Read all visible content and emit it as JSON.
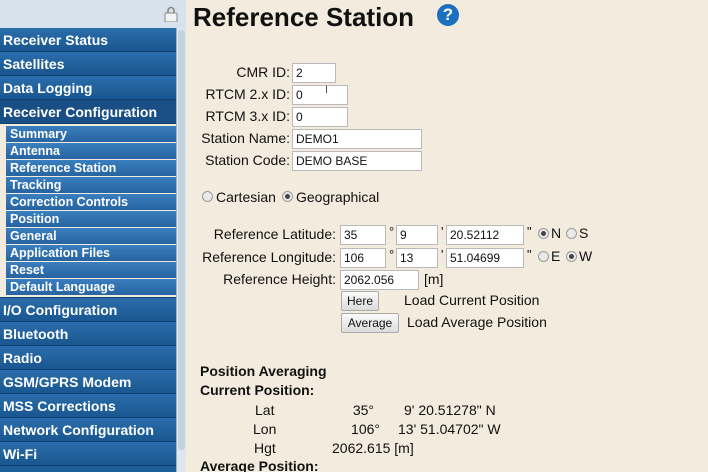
{
  "sidebar": {
    "items_top": [
      {
        "label": "Receiver Status"
      },
      {
        "label": "Satellites"
      },
      {
        "label": "Data Logging"
      },
      {
        "label": "Receiver Configuration"
      }
    ],
    "sub_items": [
      {
        "label": "Summary"
      },
      {
        "label": "Antenna"
      },
      {
        "label": "Reference Station"
      },
      {
        "label": "Tracking"
      },
      {
        "label": "Correction Controls"
      },
      {
        "label": "Position"
      },
      {
        "label": "General"
      },
      {
        "label": "Application Files"
      },
      {
        "label": "Reset"
      },
      {
        "label": "Default Language"
      }
    ],
    "items_bottom": [
      {
        "label": "I/O Configuration"
      },
      {
        "label": "Bluetooth"
      },
      {
        "label": "Radio"
      },
      {
        "label": "GSM/GPRS Modem"
      },
      {
        "label": "MSS Corrections"
      },
      {
        "label": "Network Configuration"
      },
      {
        "label": "Wi-Fi"
      }
    ]
  },
  "page": {
    "title": "Reference Station",
    "help_icon": "?"
  },
  "form": {
    "cmr_id": {
      "label": "CMR ID:",
      "value": "2"
    },
    "rtcm2_id": {
      "label": "RTCM 2.x ID:",
      "value": "0"
    },
    "rtcm3_id": {
      "label": "RTCM 3.x ID:",
      "value": "0"
    },
    "station_name": {
      "label": "Station Name:",
      "value": "DEMO1"
    },
    "station_code": {
      "label": "Station Code:",
      "value": "DEMO BASE"
    },
    "coord_mode": {
      "cartesian": "Cartesian",
      "geographical": "Geographical",
      "selected": "Geographical"
    },
    "ref_lat": {
      "label": "Reference Latitude:",
      "deg": "35",
      "min": "9",
      "sec": "20.52112",
      "hemi_n": "N",
      "hemi_s": "S",
      "selected": "N"
    },
    "ref_lon": {
      "label": "Reference Longitude:",
      "deg": "106",
      "min": "13",
      "sec": "51.04699",
      "hemi_e": "E",
      "hemi_w": "W",
      "selected": "W"
    },
    "ref_height": {
      "label": "Reference Height:",
      "value": "2062.056",
      "unit": "[m]"
    },
    "deg_symbol": "°",
    "min_symbol": "'",
    "sec_symbol": "\"",
    "here_button": "Here",
    "here_desc": "Load Current Position",
    "average_button": "Average",
    "average_desc": "Load Average Position"
  },
  "averaging": {
    "heading": "Position Averaging",
    "current_heading": "Current Position:",
    "lat_label": "Lat",
    "lat_deg": "35°",
    "lat_rest": "9' 20.51278\" N",
    "lon_label": "Lon",
    "lon_deg": "106°",
    "lon_rest": "13' 51.04702\" W",
    "hgt_label": "Hgt",
    "hgt_value": "2062.615 [m]",
    "average_heading": "Average Position:"
  },
  "colors": {
    "sidebar": "#1c5d9a",
    "background": "#f3ebdd",
    "help": "#1d6fc0"
  }
}
